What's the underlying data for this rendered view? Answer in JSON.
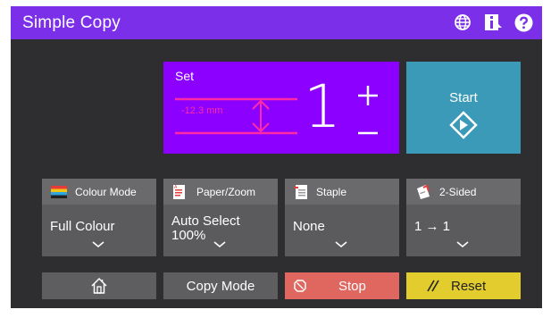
{
  "title_bar": {
    "title": "Simple Copy",
    "icons": [
      "globe-icon",
      "info-icon",
      "help-icon"
    ]
  },
  "set_panel": {
    "label": "Set",
    "copies": "1",
    "guide_value": "-12.3 mm"
  },
  "start": {
    "label": "Start"
  },
  "functions": [
    {
      "header": "Colour Mode",
      "value": "Full Colour"
    },
    {
      "header": "Paper/Zoom",
      "value": "Auto Select",
      "value2": "100%"
    },
    {
      "header": "Staple",
      "value": "None"
    },
    {
      "header": "2-Sided",
      "value": "1 → 1"
    }
  ],
  "bottom": {
    "copy_mode": "Copy Mode",
    "stop": "Stop",
    "reset": "Reset"
  },
  "colors": {
    "title_bar": "#7b2fe8",
    "set_panel": "#8b00ff",
    "start": "#3a9ab8",
    "stop": "#e0675f",
    "reset": "#e3cc2e",
    "background": "#2e2e30"
  }
}
